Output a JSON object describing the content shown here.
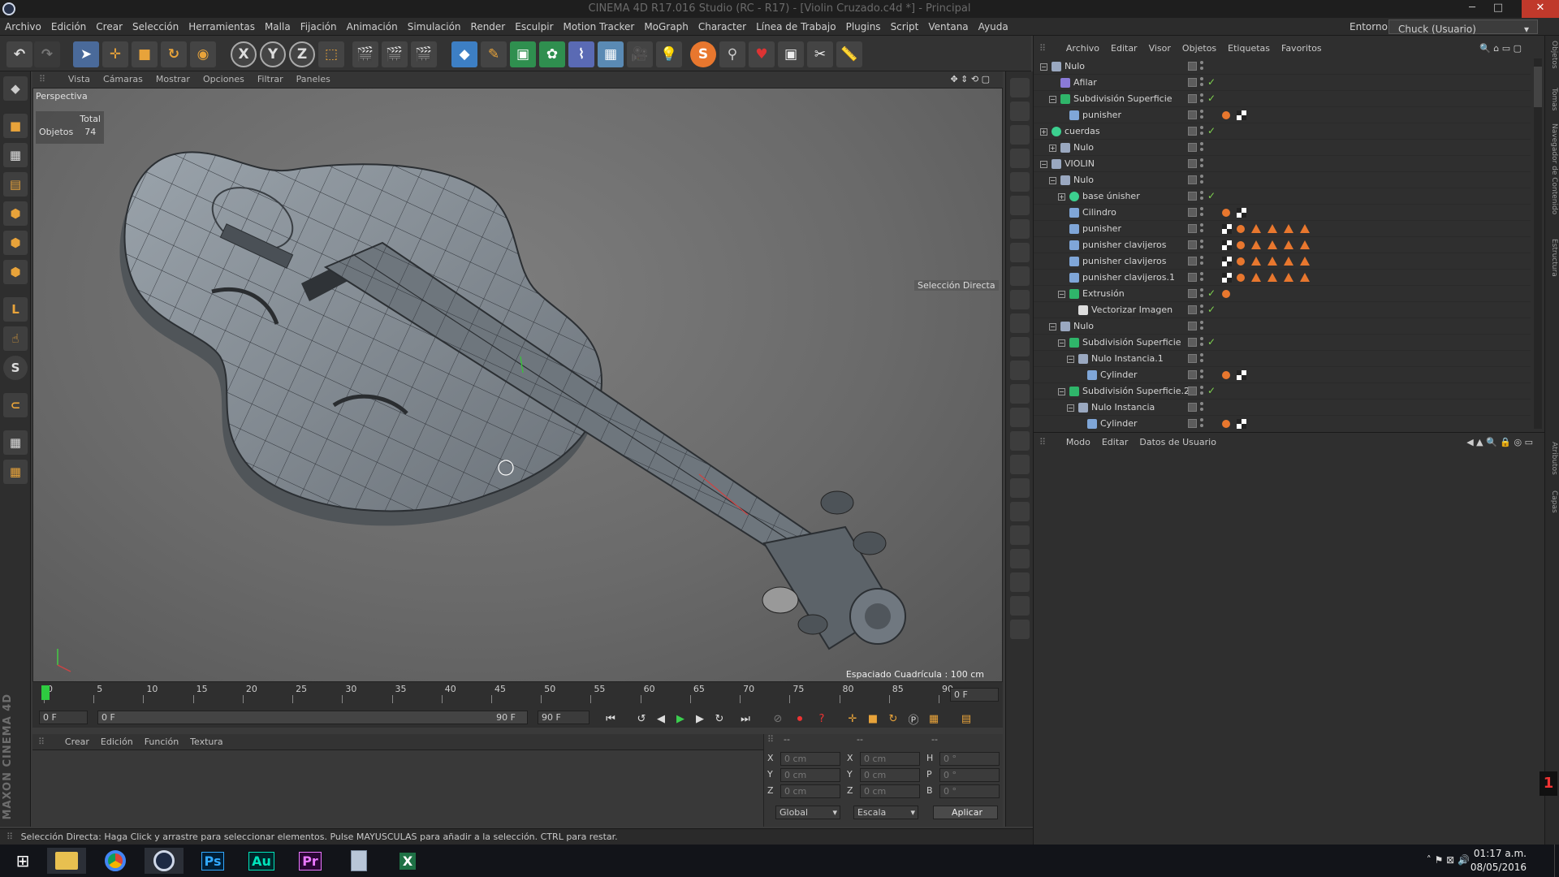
{
  "window": {
    "title": "CINEMA 4D R17.016 Studio (RC - R17) - [Violin Cruzado.c4d *] - Principal"
  },
  "menu": [
    "Archivo",
    "Edición",
    "Crear",
    "Selección",
    "Herramientas",
    "Malla",
    "Fijación",
    "Animación",
    "Simulación",
    "Render",
    "Esculpir",
    "Motion Tracker",
    "MoGraph",
    "Character",
    "Línea de Trabajo",
    "Plugins",
    "Script",
    "Ventana",
    "Ayuda"
  ],
  "environment": {
    "label": "Entorno:",
    "value": "Chuck (Usuario)"
  },
  "axis_buttons": [
    "X",
    "Y",
    "Z"
  ],
  "viewport": {
    "menu": [
      "Vista",
      "Cámaras",
      "Mostrar",
      "Opciones",
      "Filtrar",
      "Paneles"
    ],
    "camera": "Perspectiva",
    "hud": {
      "header": "Total",
      "label": "Objetos",
      "value": "74"
    },
    "tool_label": "Selección Directa",
    "grid_spacing": "Espaciado Cuadrícula : 100 cm"
  },
  "timeline": {
    "ticks": [
      "0",
      "5",
      "10",
      "15",
      "20",
      "25",
      "30",
      "35",
      "40",
      "45",
      "50",
      "55",
      "60",
      "65",
      "70",
      "75",
      "80",
      "85",
      "90"
    ],
    "current": "0 F",
    "start": "0 F",
    "range_start": "0 F",
    "range_end": "90 F",
    "end": "90 F"
  },
  "material_manager": {
    "menu": [
      "Crear",
      "Edición",
      "Función",
      "Textura"
    ]
  },
  "coordinates": {
    "headers": [
      "--",
      "--",
      "--"
    ],
    "rows": [
      {
        "a": "X",
        "av": "0 cm",
        "b": "X",
        "bv": "0 cm",
        "c": "H",
        "cv": "0 °"
      },
      {
        "a": "Y",
        "av": "0 cm",
        "b": "Y",
        "bv": "0 cm",
        "c": "P",
        "cv": "0 °"
      },
      {
        "a": "Z",
        "av": "0 cm",
        "b": "Z",
        "bv": "0 cm",
        "c": "B",
        "cv": "0 °"
      }
    ],
    "mode1": "Global",
    "mode2": "Escala",
    "apply": "Aplicar"
  },
  "status": "Selección Directa: Haga Click y arrastre para seleccionar elementos. Pulse MAYUSCULAS para añadir a la selección. CTRL para restar.",
  "object_manager": {
    "menu": [
      "Archivo",
      "Editar",
      "Visor",
      "Objetos",
      "Etiquetas",
      "Favoritos"
    ],
    "objects": [
      {
        "name": "Nulo",
        "depth": 0,
        "icon": "null",
        "exp": "-",
        "check": false,
        "tags": ""
      },
      {
        "name": "Afilar",
        "depth": 1,
        "icon": "deformer",
        "exp": "",
        "check": true,
        "tags": ""
      },
      {
        "name": "Subdivisión Superficie",
        "depth": 1,
        "icon": "subd",
        "exp": "-",
        "check": true,
        "tags": ""
      },
      {
        "name": "punisher",
        "depth": 2,
        "icon": "poly",
        "exp": "",
        "check": false,
        "tags": "pc"
      },
      {
        "name": "cuerdas",
        "depth": 0,
        "icon": "sphere",
        "exp": "+",
        "check": true,
        "tags": ""
      },
      {
        "name": "Nulo",
        "depth": 1,
        "icon": "null",
        "exp": "+",
        "check": false,
        "tags": ""
      },
      {
        "name": "VIOLIN",
        "depth": 0,
        "icon": "null",
        "exp": "-",
        "check": false,
        "tags": ""
      },
      {
        "name": "Nulo",
        "depth": 1,
        "icon": "null",
        "exp": "-",
        "check": false,
        "tags": ""
      },
      {
        "name": "base únisher",
        "depth": 2,
        "icon": "sphere",
        "exp": "+",
        "check": true,
        "tags": ""
      },
      {
        "name": "Cilindro",
        "depth": 2,
        "icon": "poly",
        "exp": "",
        "check": false,
        "tags": "pc"
      },
      {
        "name": "punisher",
        "depth": 2,
        "icon": "poly",
        "exp": "",
        "check": false,
        "tags": "cpt"
      },
      {
        "name": "punisher clavijeros",
        "depth": 2,
        "icon": "poly",
        "exp": "",
        "check": false,
        "tags": "cpt"
      },
      {
        "name": "punisher clavijeros",
        "depth": 2,
        "icon": "poly",
        "exp": "",
        "check": false,
        "tags": "cpt"
      },
      {
        "name": "punisher clavijeros.1",
        "depth": 2,
        "icon": "poly",
        "exp": "",
        "check": false,
        "tags": "cpt"
      },
      {
        "name": "Extrusión",
        "depth": 2,
        "icon": "extrude",
        "exp": "-",
        "check": true,
        "tags": "p"
      },
      {
        "name": "Vectorizar Imagen",
        "depth": 3,
        "icon": "vector",
        "exp": "",
        "check": true,
        "tags": ""
      },
      {
        "name": "Nulo",
        "depth": 1,
        "icon": "null",
        "exp": "-",
        "check": false,
        "tags": ""
      },
      {
        "name": "Subdivisión Superficie",
        "depth": 2,
        "icon": "subd",
        "exp": "-",
        "check": true,
        "tags": ""
      },
      {
        "name": "Nulo Instancia.1",
        "depth": 3,
        "icon": "null",
        "exp": "-",
        "check": false,
        "tags": ""
      },
      {
        "name": "Cylinder",
        "depth": 4,
        "icon": "poly",
        "exp": "",
        "check": false,
        "tags": "pc"
      },
      {
        "name": "Subdivisión Superficie.2",
        "depth": 2,
        "icon": "subd",
        "exp": "-",
        "check": true,
        "tags": ""
      },
      {
        "name": "Nulo Instancia",
        "depth": 3,
        "icon": "null",
        "exp": "-",
        "check": false,
        "tags": ""
      },
      {
        "name": "Cylinder",
        "depth": 4,
        "icon": "poly",
        "exp": "",
        "check": false,
        "tags": "pc"
      }
    ]
  },
  "attribute_manager": {
    "menu": [
      "Modo",
      "Editar",
      "Datos de Usuario"
    ]
  },
  "side_tabs": [
    "Objetos",
    "Tomas",
    "Navegador de Contenido",
    "Estructura",
    "Atributos",
    "Capas"
  ],
  "branding": "MAXON CINEMA 4D",
  "taskbar": {
    "apps": [
      "windows-start",
      "file-explorer",
      "chrome",
      "cinema4d",
      "photoshop",
      "audition",
      "premiere",
      "calculator",
      "excel"
    ],
    "time": "01:17 a.m.",
    "date": "08/05/2016"
  },
  "colors": {
    "accent": "#e6a23c",
    "ui_bg": "#2f2f2f",
    "viewport": "#6e6e6e",
    "check": "#7fd34f",
    "tag_orange": "#e8772e"
  }
}
